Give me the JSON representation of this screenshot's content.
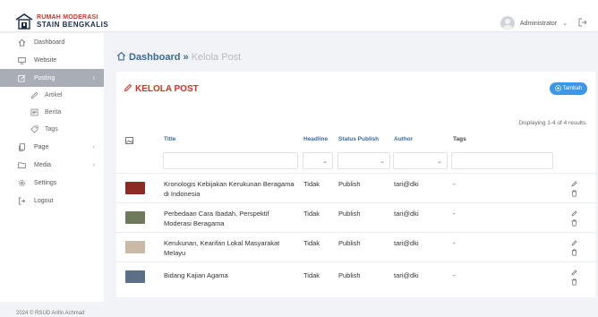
{
  "app": {
    "logo_line1": "RUMAH MODERASI",
    "logo_line2": "STAIN BENGKALIS",
    "user_name": "Administrator",
    "footer": "2024 © RSUD Arifin Achmad"
  },
  "sidebar": {
    "items": [
      {
        "label": "Dashboard",
        "icon": "home-icon"
      },
      {
        "label": "Website",
        "icon": "monitor-icon"
      },
      {
        "label": "Posting",
        "icon": "edit-icon",
        "active": true
      },
      {
        "label": "Page",
        "icon": "pages-icon"
      },
      {
        "label": "Media",
        "icon": "folder-icon"
      },
      {
        "label": "Settings",
        "icon": "gear-icon"
      },
      {
        "label": "Logout",
        "icon": "logout-icon"
      }
    ],
    "posting_sub": [
      {
        "label": "Artikel",
        "icon": "pencil-icon"
      },
      {
        "label": "Berita",
        "icon": "news-icon"
      },
      {
        "label": "Tags",
        "icon": "tag-icon"
      }
    ]
  },
  "breadcrumb": {
    "home": "Dashboard",
    "separator": "»",
    "current": "Kelola Post"
  },
  "main": {
    "title": "KELOLA POST",
    "add_label": "Tambah",
    "summary": "Displaying 1-4 of 4 results.",
    "columns": {
      "title": "Title",
      "headline": "Headline",
      "status": "Status Publish",
      "author": "Author",
      "tags": "Tags"
    },
    "rows": [
      {
        "title": "Kronologis Kebijakan Kerukunan Beragama di Indonesia",
        "headline": "Tidak",
        "status": "Publish",
        "author": "tari@dki",
        "tags": "-",
        "thumb": "#8c2a24"
      },
      {
        "title": "Perbedaan Cara Ibadah, Perspektif Moderasi Beragama",
        "headline": "Tidak",
        "status": "Publish",
        "author": "tari@dki",
        "tags": "-",
        "thumb": "#6f7a5c"
      },
      {
        "title": "Kerukunan, Kearifan Lokal Masyarakat Melayu",
        "headline": "Tidak",
        "status": "Publish",
        "author": "tari@dki",
        "tags": "-",
        "thumb": "#c9b9a6"
      },
      {
        "title": "Bidang Kajian Agama",
        "headline": "Tidak",
        "status": "Publish",
        "author": "tari@dki",
        "tags": "-",
        "thumb": "#5b6f86"
      }
    ]
  },
  "colors": {
    "accent": "#3a6a9b",
    "title_red": "#d93025",
    "button_blue": "#3c97e8",
    "sidebar_active": "#a9aeb6"
  }
}
